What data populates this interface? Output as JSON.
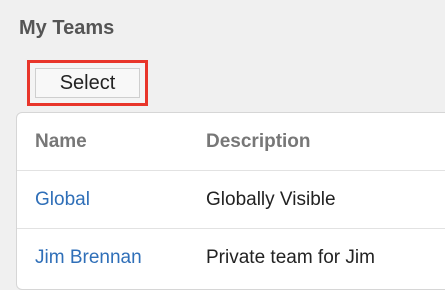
{
  "panel": {
    "title": "My Teams"
  },
  "toolbar": {
    "select_label": "Select",
    "highlight_color": "#e8352a"
  },
  "table": {
    "headers": [
      "Name",
      "Description"
    ],
    "rows": [
      {
        "name": "Global",
        "description": "Globally Visible"
      },
      {
        "name": "Jim Brennan",
        "description": "Private team for Jim"
      }
    ]
  }
}
